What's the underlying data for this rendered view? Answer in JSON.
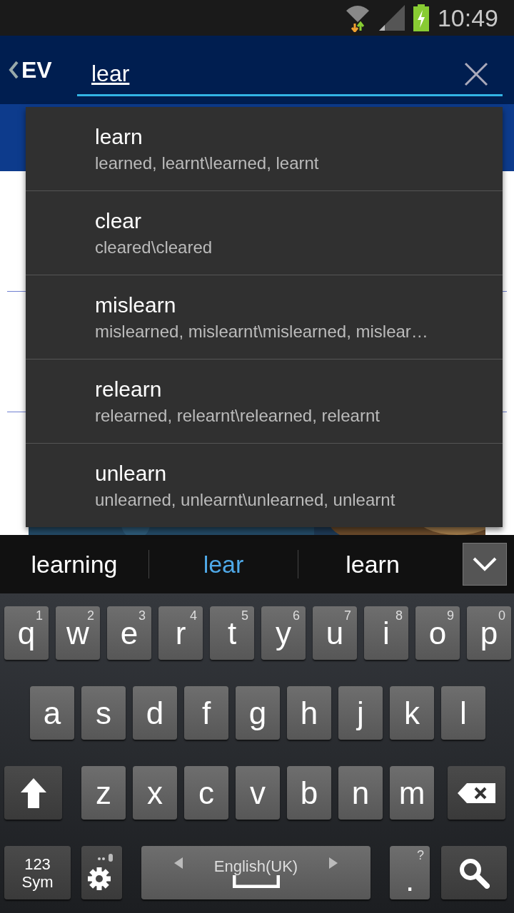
{
  "status_bar": {
    "time": "10:49"
  },
  "app_bar": {
    "logo": "EV",
    "query": "lear"
  },
  "suggestions": [
    {
      "word": "learn",
      "forms": "learned, learnt\\learned, learnt"
    },
    {
      "word": "clear",
      "forms": "cleared\\cleared"
    },
    {
      "word": "mislearn",
      "forms": "mislearned, mislearnt\\mislearned, mislear…"
    },
    {
      "word": "relearn",
      "forms": "relearned, relearnt\\relearned, relearnt"
    },
    {
      "word": "unlearn",
      "forms": "unlearned, unlearnt\\unlearned, unlearnt"
    }
  ],
  "keyboard": {
    "candidates": [
      {
        "text": "learning",
        "selected": false
      },
      {
        "text": "lear",
        "selected": true
      },
      {
        "text": "learn",
        "selected": false
      }
    ],
    "letter_rows": [
      [
        {
          "label": "q",
          "hint": "1"
        },
        {
          "label": "w",
          "hint": "2"
        },
        {
          "label": "e",
          "hint": "3"
        },
        {
          "label": "r",
          "hint": "4"
        },
        {
          "label": "t",
          "hint": "5"
        },
        {
          "label": "y",
          "hint": "6"
        },
        {
          "label": "u",
          "hint": "7"
        },
        {
          "label": "i",
          "hint": "8"
        },
        {
          "label": "o",
          "hint": "9"
        },
        {
          "label": "p",
          "hint": "0"
        }
      ],
      [
        {
          "label": "a"
        },
        {
          "label": "s"
        },
        {
          "label": "d"
        },
        {
          "label": "f"
        },
        {
          "label": "g"
        },
        {
          "label": "h"
        },
        {
          "label": "j"
        },
        {
          "label": "k"
        },
        {
          "label": "l"
        }
      ],
      [
        {
          "label": "z"
        },
        {
          "label": "x"
        },
        {
          "label": "c"
        },
        {
          "label": "v"
        },
        {
          "label": "b"
        },
        {
          "label": "n"
        },
        {
          "label": "m"
        }
      ]
    ],
    "function_keys": [
      {
        "kind": "sym",
        "label": "123",
        "hint": "Sym"
      },
      {
        "kind": "settings"
      },
      {
        "kind": "space",
        "label": "English(UK)"
      },
      {
        "kind": "period",
        "label": ".",
        "hint": "?"
      },
      {
        "kind": "search"
      }
    ]
  }
}
